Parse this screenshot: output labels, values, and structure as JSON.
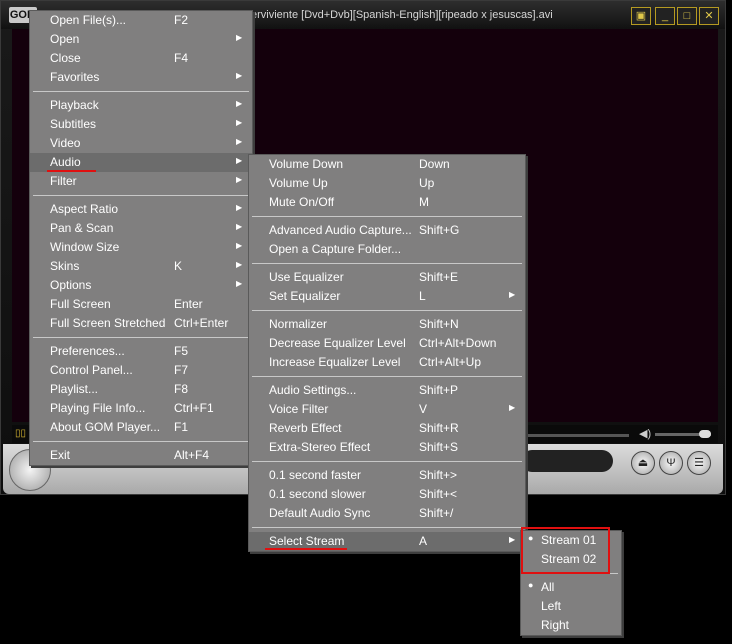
{
  "window": {
    "logo": "GOM",
    "title": "erviviente [Dvd+Dvb][Spanish-English][ripeado x jesuscas].avi",
    "buttons": [
      "▣",
      "_",
      "□",
      "✕"
    ]
  },
  "main_menu": {
    "groups": [
      [
        {
          "label": "Open File(s)...",
          "shortcut": "F2",
          "submenu": false
        },
        {
          "label": "Open",
          "shortcut": "",
          "submenu": true
        },
        {
          "label": "Close",
          "shortcut": "F4",
          "submenu": false
        },
        {
          "label": "Favorites",
          "shortcut": "",
          "submenu": true
        }
      ],
      [
        {
          "label": "Playback",
          "shortcut": "",
          "submenu": true
        },
        {
          "label": "Subtitles",
          "shortcut": "",
          "submenu": true
        },
        {
          "label": "Video",
          "shortcut": "",
          "submenu": true
        },
        {
          "label": "Audio",
          "shortcut": "",
          "submenu": true,
          "active": true
        },
        {
          "label": "Filter",
          "shortcut": "",
          "submenu": true
        }
      ],
      [
        {
          "label": "Aspect Ratio",
          "shortcut": "",
          "submenu": true
        },
        {
          "label": "Pan & Scan",
          "shortcut": "",
          "submenu": true
        },
        {
          "label": "Window Size",
          "shortcut": "",
          "submenu": true
        },
        {
          "label": "Skins",
          "shortcut": "K",
          "submenu": true
        },
        {
          "label": "Options",
          "shortcut": "",
          "submenu": true
        },
        {
          "label": "Full Screen",
          "shortcut": "Enter",
          "submenu": false
        },
        {
          "label": "Full Screen Stretched",
          "shortcut": "Ctrl+Enter",
          "submenu": false
        }
      ],
      [
        {
          "label": "Preferences...",
          "shortcut": "F5",
          "submenu": false
        },
        {
          "label": "Control Panel...",
          "shortcut": "F7",
          "submenu": false
        },
        {
          "label": "Playlist...",
          "shortcut": "F8",
          "submenu": false
        },
        {
          "label": "Playing File Info...",
          "shortcut": "Ctrl+F1",
          "submenu": false
        },
        {
          "label": "About GOM Player...",
          "shortcut": "F1",
          "submenu": false
        }
      ],
      [
        {
          "label": "Exit",
          "shortcut": "Alt+F4",
          "submenu": false
        }
      ]
    ]
  },
  "audio_menu": {
    "groups": [
      [
        {
          "label": "Volume Down",
          "shortcut": "Down",
          "submenu": false
        },
        {
          "label": "Volume Up",
          "shortcut": "Up",
          "submenu": false
        },
        {
          "label": "Mute On/Off",
          "shortcut": "M",
          "submenu": false
        }
      ],
      [
        {
          "label": "Advanced Audio Capture...",
          "shortcut": "Shift+G",
          "submenu": false
        },
        {
          "label": "Open a Capture Folder...",
          "shortcut": "",
          "submenu": false
        }
      ],
      [
        {
          "label": "Use Equalizer",
          "shortcut": "Shift+E",
          "submenu": false
        },
        {
          "label": "Set Equalizer",
          "shortcut": "L",
          "submenu": true
        }
      ],
      [
        {
          "label": "Normalizer",
          "shortcut": "Shift+N",
          "submenu": false
        },
        {
          "label": "Decrease Equalizer Level",
          "shortcut": "Ctrl+Alt+Down",
          "submenu": false
        },
        {
          "label": "Increase Equalizer Level",
          "shortcut": "Ctrl+Alt+Up",
          "submenu": false
        }
      ],
      [
        {
          "label": "Audio Settings...",
          "shortcut": "Shift+P",
          "submenu": false
        },
        {
          "label": "Voice Filter",
          "shortcut": "V",
          "submenu": true
        },
        {
          "label": "Reverb Effect",
          "shortcut": "Shift+R",
          "submenu": false
        },
        {
          "label": "Extra-Stereo Effect",
          "shortcut": "Shift+S",
          "submenu": false
        }
      ],
      [
        {
          "label": "0.1 second faster",
          "shortcut": "Shift+>",
          "submenu": false
        },
        {
          "label": "0.1 second slower",
          "shortcut": "Shift+<",
          "submenu": false
        },
        {
          "label": "Default Audio Sync",
          "shortcut": "Shift+/",
          "submenu": false
        }
      ],
      [
        {
          "label": "Select Stream",
          "shortcut": "A",
          "submenu": true,
          "active": true
        }
      ]
    ]
  },
  "stream_menu": {
    "groups": [
      [
        {
          "label": "Stream 01",
          "checked": true
        },
        {
          "label": "Stream 02",
          "checked": false
        }
      ],
      [
        {
          "label": "All",
          "checked": true
        },
        {
          "label": "Left",
          "checked": false
        },
        {
          "label": "Right",
          "checked": false
        }
      ]
    ]
  },
  "controls": {
    "stop": "⏏",
    "playlist": "Ψ",
    "menu": "☰",
    "volume_icon": "◀)",
    "frame_icon": "▯▯"
  },
  "colors": {
    "menu_bg": "#807f7f",
    "highlight_underline": "#e01010"
  }
}
